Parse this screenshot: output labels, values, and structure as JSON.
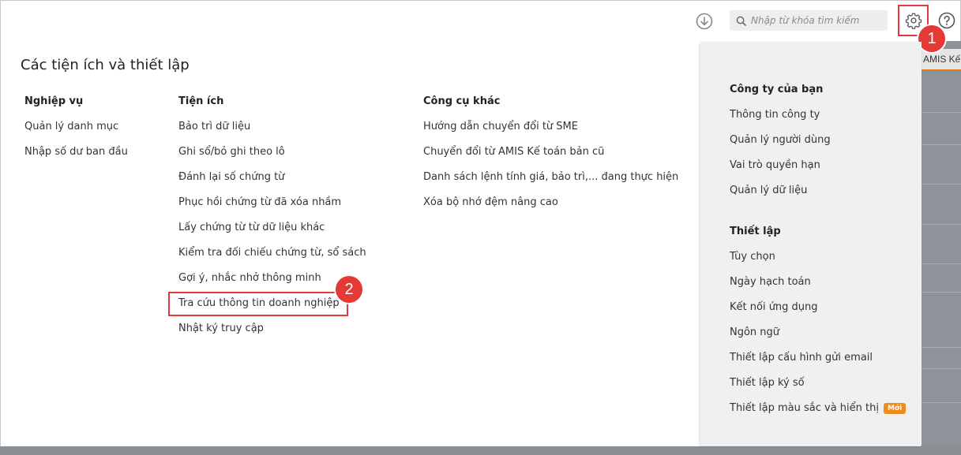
{
  "toolbar": {
    "search_placeholder": "Nhập từ khóa tìm kiếm",
    "icons": [
      "download-icon",
      "search-icon",
      "gear-icon",
      "help-icon"
    ]
  },
  "annotations": {
    "step1": "1",
    "step2": "2",
    "color": "#e53935"
  },
  "background_app": {
    "header_text": "AMIS Kế"
  },
  "page": {
    "title": "Các tiện ích và thiết lập"
  },
  "columns": {
    "nghiep_vu": {
      "title": "Nghiệp vụ",
      "items": [
        "Quản lý danh mục",
        "Nhập số dư ban đầu"
      ]
    },
    "tien_ich": {
      "title": "Tiện ích",
      "items": [
        "Bảo trì dữ liệu",
        "Ghi sổ/bỏ ghi theo lô",
        "Đánh lại số chứng từ",
        "Phục hồi chứng từ đã xóa nhầm",
        "Lấy chứng từ từ dữ liệu khác",
        "Kiểm tra đối chiếu chứng từ, sổ sách",
        "Gợi ý, nhắc nhở thông minh",
        "Tra cứu thông tin doanh nghiệp",
        "Nhật ký truy cập"
      ]
    },
    "cong_cu_khac": {
      "title": "Công cụ khác",
      "items": [
        "Hướng dẫn chuyển đổi từ SME",
        "Chuyển đổi từ AMIS Kế toán bản cũ",
        "Danh sách lệnh tính giá, bảo trì,... đang thực hiện",
        "Xóa bộ nhớ đệm nâng cao"
      ]
    }
  },
  "settings_panel": {
    "company": {
      "title": "Công ty của bạn",
      "items": [
        "Thông tin công ty",
        "Quản lý người dùng",
        "Vai trò quyền hạn",
        "Quản lý dữ liệu"
      ]
    },
    "setup": {
      "title": "Thiết lập",
      "items": [
        "Tùy chọn",
        "Ngày hạch toán",
        "Kết nối ứng dụng",
        "Ngôn ngữ",
        "Thiết lập cấu hình gửi email",
        "Thiết lập ký số",
        "Thiết lập màu sắc và hiển thị"
      ],
      "new_badge": "Mới"
    }
  },
  "colors": {
    "highlight": "#e03a3a",
    "new_badge": "#f08c1f",
    "panel_bg": "#eef0f2"
  }
}
